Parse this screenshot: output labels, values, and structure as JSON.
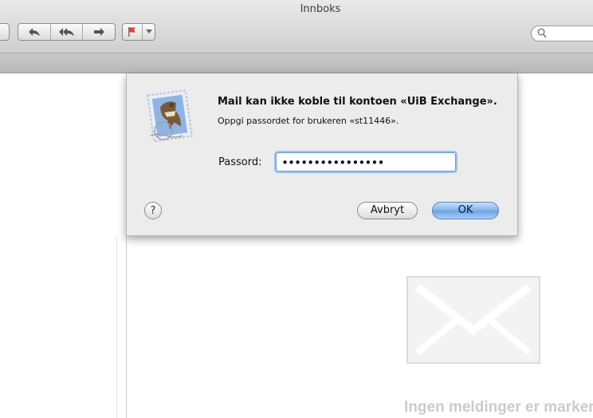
{
  "window": {
    "title": "Innboks"
  },
  "toolbar": {
    "search": {
      "placeholder": ""
    },
    "icons": [
      "reply-icon",
      "reply-all-icon",
      "forward-icon",
      "flag-icon",
      "dropdown-arrow-icon",
      "search-icon"
    ]
  },
  "alert": {
    "title": "Mail kan ikke koble til kontoen «UiB Exchange».",
    "message": "Oppgi passordet for brukeren «st11446».",
    "password_label": "Passord:",
    "password_value": "••••••••••••••••",
    "help_label": "?",
    "cancel_label": "Avbryt",
    "ok_label": "OK"
  },
  "viewer": {
    "empty_text": "Ingen meldinger er markert"
  },
  "colors": {
    "ok_button": "#7fb1ec",
    "field_focus": "#9cc2f0",
    "empty_text": "#cbcbcb"
  }
}
